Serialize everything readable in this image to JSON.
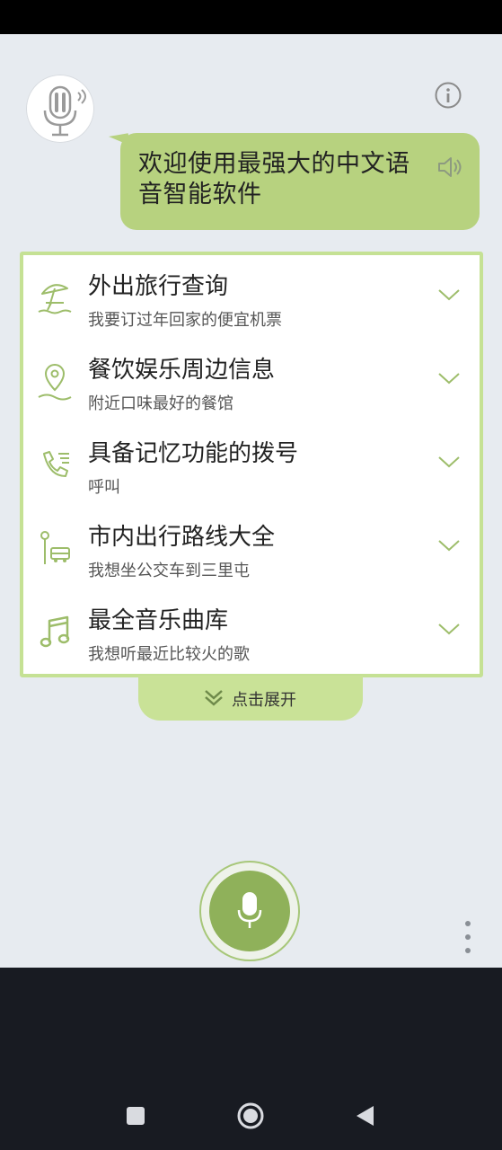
{
  "app": {
    "welcome_text": "欢迎使用最强大的中文语音智能软件",
    "expand_label": "点击展开"
  },
  "features": [
    {
      "title": "外出旅行查询",
      "subtitle": "我要订过年回家的便宜机票",
      "icon": "beach-umbrella-icon"
    },
    {
      "title": "餐饮娱乐周边信息",
      "subtitle": "附近口味最好的餐馆",
      "icon": "location-pin-icon"
    },
    {
      "title": "具备记忆功能的拨号",
      "subtitle": "呼叫",
      "icon": "phone-call-icon"
    },
    {
      "title": "市内出行路线大全",
      "subtitle": "我想坐公交车到三里屯",
      "icon": "bus-stop-icon"
    },
    {
      "title": "最全音乐曲库",
      "subtitle": "我想听最近比较火的歌",
      "icon": "music-note-icon"
    }
  ],
  "colors": {
    "accent": "#b7d27f",
    "accent_dark": "#8fb15a",
    "list_border": "#c5e194",
    "icon_green": "#9dbd6a",
    "background": "#e7ebf0",
    "navbar": "#181b22"
  }
}
